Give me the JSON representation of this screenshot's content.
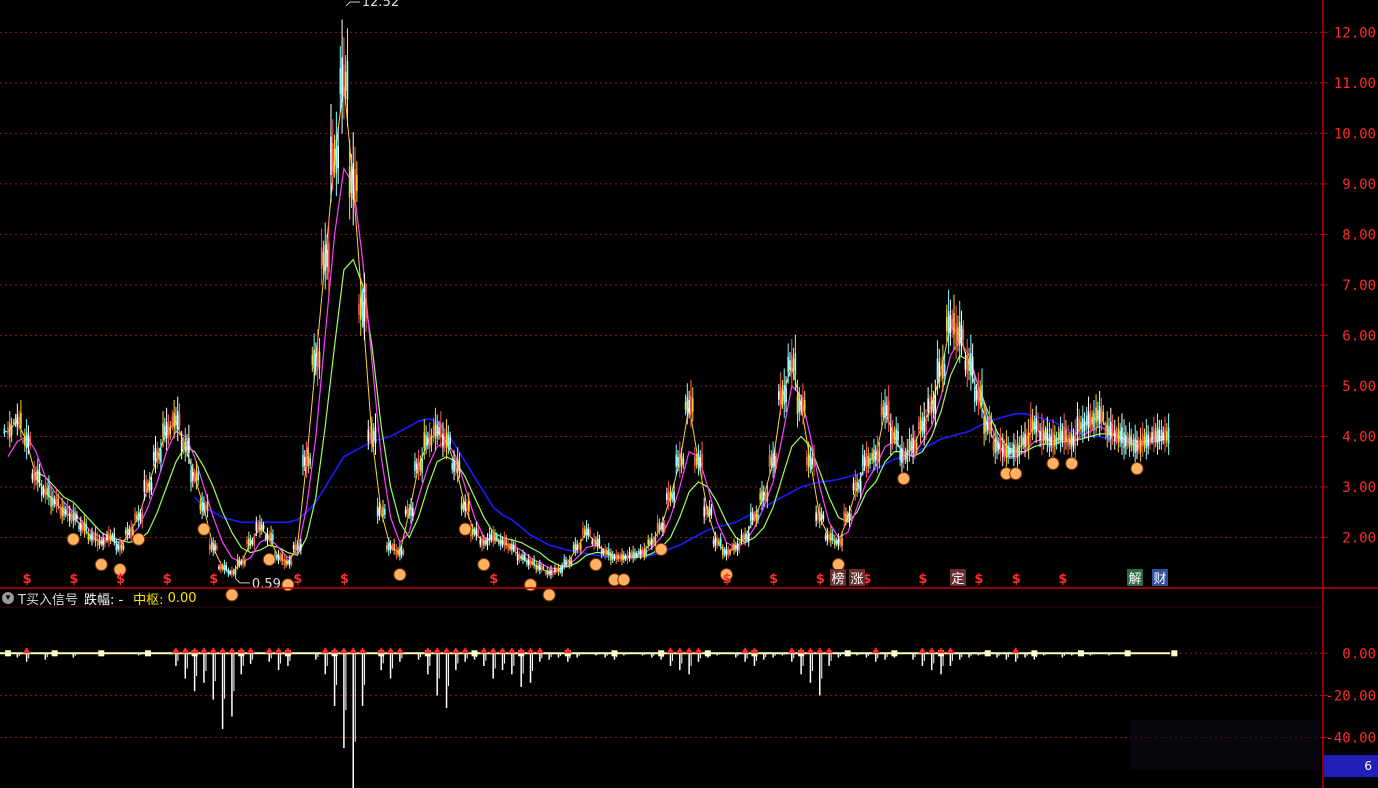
{
  "indicator": {
    "icon": "collapse-icon",
    "name": "T买入信号",
    "amp_label": "跌幅: -",
    "center_label": "中枢:",
    "center_value": "0.00"
  },
  "corner_value": "6",
  "colors": {
    "background": "#000000",
    "axis": "#c00000",
    "grid": "#8a1a1a",
    "axis_label": "#ff2a2a",
    "ma_short": "#ffffff",
    "ma_mid": "#ffd23a",
    "ma_magenta": "#ff40ff",
    "ma_green": "#9cff5a",
    "ma_blue": "#1c1cff",
    "signal": "#ff2a2a",
    "hand": "#ffb060"
  },
  "chart_data": [
    {
      "type": "line",
      "panel": "price",
      "y_ticks": [
        "12.00",
        "11.00",
        "10.00",
        "9.00",
        "8.00",
        "7.00",
        "6.00",
        "5.00",
        "4.00",
        "3.00",
        "2.00"
      ],
      "ylim": [
        1.0,
        12.64
      ],
      "grid": true,
      "high_label": "12.52",
      "low_label": "0.59",
      "series": [
        {
          "key": "close",
          "values": [
            4.1,
            4.3,
            3.9,
            3.2,
            2.9,
            2.7,
            2.5,
            2.4,
            2.2,
            2.0,
            1.9,
            2.0,
            1.8,
            2.1,
            2.4,
            3.0,
            3.6,
            4.1,
            4.3,
            3.8,
            3.2,
            2.6,
            1.8,
            1.4,
            1.3,
            1.5,
            1.9,
            2.2,
            2.0,
            1.6,
            1.5,
            1.8,
            3.5,
            5.5,
            7.5,
            9.5,
            11.0,
            9.0,
            6.5,
            4.0,
            2.5,
            1.8,
            1.7,
            2.5,
            3.4,
            3.9,
            4.1,
            3.9,
            3.4,
            2.6,
            2.1,
            1.9,
            2.0,
            1.9,
            1.8,
            1.6,
            1.5,
            1.4,
            1.3,
            1.35,
            1.5,
            1.8,
            2.1,
            1.9,
            1.7,
            1.6,
            1.6,
            1.65,
            1.7,
            1.9,
            2.2,
            2.8,
            3.5,
            4.6,
            3.5,
            2.5,
            1.9,
            1.7,
            1.8,
            2.0,
            2.4,
            2.8,
            3.5,
            4.8,
            5.4,
            4.6,
            3.5,
            2.4,
            2.0,
            1.9,
            2.4,
            3.0,
            3.5,
            3.6,
            4.5,
            4.0,
            3.6,
            3.8,
            4.2,
            4.6,
            5.3,
            6.2,
            6.0,
            5.4,
            4.8,
            4.2,
            3.8,
            3.7,
            3.7,
            3.9,
            4.2,
            4.0,
            3.9,
            4.0,
            3.9,
            4.2,
            4.3,
            4.4,
            4.1,
            4.0,
            3.9,
            3.8,
            3.9,
            4.0,
            4.0
          ]
        },
        {
          "key": "ma_magenta",
          "values": [
            3.6,
            3.9,
            4.0,
            3.7,
            3.2,
            2.9,
            2.7,
            2.5,
            2.3,
            2.1,
            2.0,
            1.95,
            1.9,
            2.0,
            2.2,
            2.6,
            3.1,
            3.7,
            4.1,
            4.0,
            3.6,
            3.0,
            2.4,
            1.9,
            1.6,
            1.5,
            1.6,
            1.9,
            2.0,
            1.8,
            1.6,
            1.7,
            2.6,
            4.0,
            6.0,
            8.0,
            9.3,
            9.0,
            7.5,
            5.5,
            3.6,
            2.4,
            1.9,
            2.1,
            2.8,
            3.4,
            3.8,
            3.9,
            3.6,
            3.0,
            2.4,
            2.0,
            1.95,
            1.9,
            1.85,
            1.75,
            1.6,
            1.5,
            1.4,
            1.38,
            1.45,
            1.6,
            1.8,
            1.85,
            1.75,
            1.65,
            1.62,
            1.62,
            1.66,
            1.8,
            2.0,
            2.4,
            3.0,
            3.7,
            3.6,
            3.0,
            2.3,
            1.9,
            1.8,
            1.9,
            2.2,
            2.6,
            3.1,
            4.0,
            5.0,
            4.8,
            4.0,
            3.0,
            2.3,
            2.0,
            2.1,
            2.6,
            3.1,
            3.4,
            3.8,
            3.9,
            3.7,
            3.6,
            3.9,
            4.2,
            4.8,
            5.6,
            5.9,
            5.6,
            5.0,
            4.4,
            3.9,
            3.6,
            3.6,
            3.7,
            3.9,
            3.95,
            3.9,
            3.95,
            3.9,
            4.0,
            4.1,
            4.2,
            4.1,
            4.0,
            3.95,
            3.9,
            3.9,
            3.95,
            4.0
          ]
        },
        {
          "key": "ma_green",
          "values": [
            null,
            null,
            null,
            3.3,
            3.2,
            3.0,
            2.8,
            2.7,
            2.5,
            2.3,
            2.1,
            2.0,
            1.95,
            1.9,
            1.95,
            2.1,
            2.5,
            3.0,
            3.5,
            3.8,
            3.7,
            3.4,
            3.0,
            2.5,
            2.1,
            1.8,
            1.7,
            1.75,
            1.85,
            1.8,
            1.7,
            1.65,
            2.0,
            2.8,
            4.2,
            5.8,
            7.3,
            7.5,
            7.0,
            5.8,
            4.2,
            3.0,
            2.3,
            2.0,
            2.4,
            3.0,
            3.5,
            3.6,
            3.5,
            3.2,
            2.8,
            2.4,
            2.1,
            2.0,
            1.95,
            1.9,
            1.8,
            1.7,
            1.55,
            1.45,
            1.42,
            1.5,
            1.65,
            1.7,
            1.7,
            1.65,
            1.62,
            1.6,
            1.62,
            1.68,
            1.8,
            2.0,
            2.4,
            2.9,
            3.1,
            3.0,
            2.7,
            2.3,
            2.0,
            1.9,
            2.0,
            2.2,
            2.6,
            3.2,
            3.8,
            4.0,
            3.8,
            3.3,
            2.8,
            2.4,
            2.3,
            2.5,
            2.9,
            3.1,
            3.5,
            3.7,
            3.7,
            3.6,
            3.7,
            4.0,
            4.5,
            5.2,
            5.6,
            5.5,
            5.0,
            4.5,
            4.1,
            3.8,
            3.7,
            3.7,
            3.8,
            3.85,
            3.85,
            3.9,
            3.9,
            3.95,
            4.0,
            4.05,
            4.05,
            4.0,
            3.95,
            3.9,
            3.9,
            3.9,
            3.95
          ]
        },
        {
          "key": "ma_blue",
          "values": [
            null,
            null,
            null,
            null,
            null,
            null,
            null,
            null,
            null,
            null,
            null,
            null,
            null,
            null,
            null,
            null,
            null,
            null,
            null,
            null,
            2.8,
            2.6,
            2.5,
            2.4,
            2.35,
            2.3,
            2.3,
            2.3,
            2.3,
            2.3,
            2.3,
            2.35,
            2.5,
            2.7,
            3.0,
            3.3,
            3.6,
            3.7,
            3.8,
            3.9,
            3.95,
            4.0,
            4.1,
            4.2,
            4.3,
            4.35,
            4.3,
            4.1,
            3.8,
            3.5,
            3.2,
            2.9,
            2.6,
            2.45,
            2.35,
            2.2,
            2.05,
            1.95,
            1.85,
            1.8,
            1.75,
            1.72,
            1.68,
            1.65,
            1.62,
            1.6,
            1.6,
            1.6,
            1.62,
            1.65,
            1.7,
            1.78,
            1.85,
            1.95,
            2.05,
            2.15,
            2.2,
            2.25,
            2.3,
            2.4,
            2.5,
            2.6,
            2.7,
            2.8,
            2.9,
            3.0,
            3.05,
            3.1,
            3.12,
            3.15,
            3.2,
            3.25,
            3.3,
            3.35,
            3.45,
            3.55,
            3.6,
            3.65,
            3.75,
            3.85,
            3.95,
            4.0,
            4.05,
            4.1,
            4.2,
            4.3,
            4.35,
            4.4,
            4.45,
            4.45,
            4.4,
            4.35,
            4.3,
            4.2,
            4.1,
            4.05,
            4.0,
            4.0,
            3.95,
            3.9,
            3.9,
            3.9,
            3.9,
            3.92,
            3.95
          ]
        }
      ]
    },
    {
      "type": "bar",
      "panel": "indicator",
      "y_ticks": [
        "0.00",
        "-20.00",
        "-40.00"
      ],
      "ylim": [
        -64.0,
        22.0
      ],
      "values": [
        0,
        -2,
        -4,
        0,
        -3,
        0,
        0,
        -2,
        0,
        0,
        0,
        0,
        0,
        0,
        -1,
        0,
        0,
        0,
        -6,
        -12,
        -18,
        -14,
        -22,
        -36,
        -30,
        -10,
        -5,
        0,
        -4,
        -8,
        -6,
        0,
        0,
        -3,
        -10,
        -25,
        -45,
        -70,
        -25,
        0,
        -8,
        -12,
        -4,
        0,
        -3,
        -10,
        -20,
        -26,
        -8,
        -4,
        -3,
        -6,
        -12,
        -8,
        -10,
        -16,
        -14,
        -4,
        -3,
        -2,
        -4,
        -2,
        0,
        -1,
        -2,
        -3,
        -1,
        0,
        -1,
        -2,
        -3,
        -6,
        -8,
        -10,
        -4,
        -2,
        -1,
        0,
        -2,
        -4,
        -6,
        -3,
        -2,
        -1,
        -4,
        -10,
        -14,
        -20,
        -6,
        -2,
        0,
        -1,
        -2,
        -4,
        -3,
        -2,
        0,
        -3,
        -6,
        -8,
        -10,
        -6,
        -3,
        -2,
        -1,
        0,
        -2,
        -3,
        -4,
        -2,
        -3,
        -1,
        0,
        -2,
        -1,
        0,
        -1,
        0,
        -1,
        0,
        0,
        0,
        0,
        0,
        0,
        0,
        0
      ]
    }
  ],
  "tags": [
    {
      "label": "榜"
    },
    {
      "label": "涨"
    },
    {
      "label": "定"
    },
    {
      "label": "解"
    },
    {
      "label": "财"
    }
  ]
}
